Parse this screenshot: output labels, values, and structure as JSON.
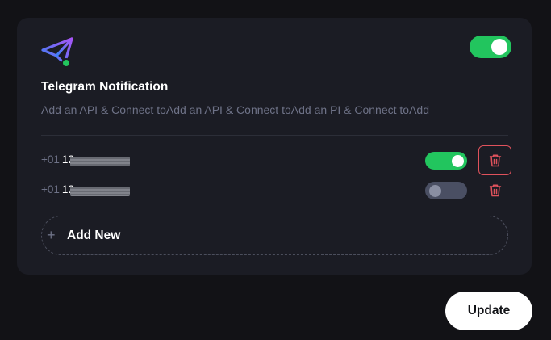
{
  "card": {
    "title": "Telegram Notification",
    "description": "Add an API & Connect toAdd an API & Connect toAdd an PI & Connect toAdd",
    "enabled": true,
    "logo_icon": "paper-plane-icon"
  },
  "phones": [
    {
      "country_code": "+01",
      "number_prefix": "12",
      "enabled": true
    },
    {
      "country_code": "+01",
      "number_prefix": "12",
      "enabled": false
    }
  ],
  "add_new": {
    "label": "Add New",
    "icon": "plus-icon"
  },
  "update_label": "Update",
  "colors": {
    "accent_green": "#22c55e",
    "danger_red": "#e0525c",
    "card_bg": "#1b1c24"
  }
}
